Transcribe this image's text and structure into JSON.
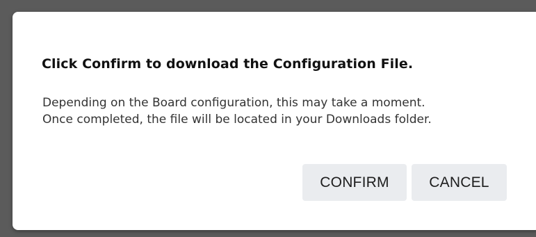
{
  "dialog": {
    "title": "Click Confirm to download the Configuration File.",
    "body_line1": "Depending on the Board configuration, this may take a moment.",
    "body_line2": "Once completed, the file will be located in your Downloads folder.",
    "confirm_label": "CONFIRM",
    "cancel_label": "CANCEL"
  },
  "colors": {
    "backdrop": "#5b5b5b",
    "dialog_bg": "#ffffff",
    "button_bg": "#eaecef",
    "title_text": "#111111",
    "body_text": "#333333"
  }
}
